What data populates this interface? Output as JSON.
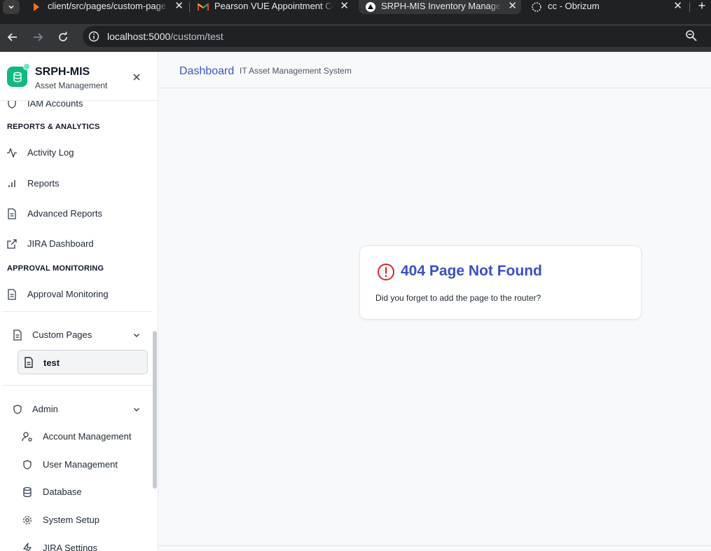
{
  "browser": {
    "tabs": [
      {
        "title": "client/src/pages/custom-page.tsx",
        "icon": "code-editor-icon",
        "active": false
      },
      {
        "title": "Pearson VUE Appointment Confirmation",
        "icon": "gmail-icon",
        "active": false
      },
      {
        "title": "SRPH-MIS Inventory Management",
        "icon": "app-triangle-icon",
        "active": true
      },
      {
        "title": "cc - Obrizum",
        "icon": "obrizum-icon",
        "active": false
      }
    ],
    "tab_close_glyph": "✕",
    "new_tab_glyph": "+",
    "url_host": "localhost:5000",
    "url_path": "/custom/test"
  },
  "sidebar": {
    "brand_name": "SRPH-MIS",
    "brand_sub": "Asset Management",
    "close_glyph": "✕",
    "partial_item": "IAM Accounts",
    "sections": {
      "reports": "REPORTS & ANALYTICS",
      "approval": "APPROVAL MONITORING"
    },
    "reports_items": [
      {
        "label": "Activity Log",
        "icon": "activity-icon"
      },
      {
        "label": "Reports",
        "icon": "bar-chart-icon"
      },
      {
        "label": "Advanced Reports",
        "icon": "document-icon"
      },
      {
        "label": "JIRA Dashboard",
        "icon": "external-link-icon"
      }
    ],
    "approval_items": [
      {
        "label": "Approval Monitoring",
        "icon": "document-icon"
      }
    ],
    "custom_pages": {
      "label": "Custom Pages",
      "children": [
        {
          "label": "test",
          "active": true
        }
      ]
    },
    "admin": {
      "label": "Admin",
      "children": [
        {
          "label": "Account Management",
          "icon": "user-cog-icon"
        },
        {
          "label": "User Management",
          "icon": "shield-icon"
        },
        {
          "label": "Database",
          "icon": "database-icon"
        },
        {
          "label": "System Setup",
          "icon": "gear-icon"
        },
        {
          "label": "JIRA Settings",
          "icon": "zap-icon"
        }
      ]
    }
  },
  "header": {
    "title": "Dashboard",
    "subtitle": "IT Asset Management System"
  },
  "not_found": {
    "title": "404 Page Not Found",
    "message": "Did you forget to add the page to the router?",
    "icon": "alert-circle-icon",
    "accent": "#dc2626",
    "title_color": "#3b4fc4"
  },
  "colors": {
    "brand": "#10b981",
    "header_link": "#3b55c6"
  }
}
